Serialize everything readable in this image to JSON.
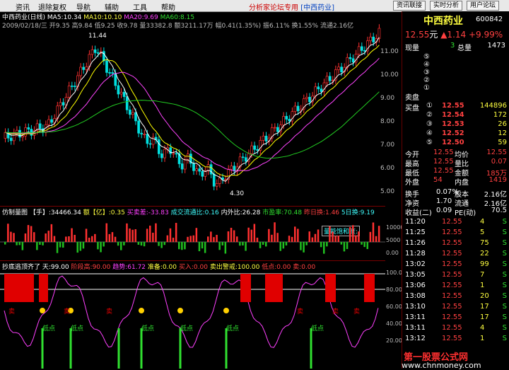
{
  "menu": {
    "items": [
      "资讯",
      "退除复权",
      "导航",
      "辅助",
      "工具",
      "帮助"
    ],
    "forum_text": "分析家论坛专用",
    "forum_link": "[中西药业]",
    "buttons": [
      "资讯联接",
      "实时分析",
      "用户论坛"
    ]
  },
  "chart": {
    "title": "中西药业(日线)",
    "ma5": "MA5:10.34",
    "ma10": "MA10:10.10",
    "ma20": "MA20:9.69",
    "ma60": "MA60:8.15",
    "info_line": "2009/02/18/三 开9.35 高9.84 低9.25 收9.78 量33382.8 额3211.17万 幅0.41(1.35%) 振6.11% 换1.55% 流通2.16亿",
    "high_label": "11.44",
    "low_label": "4.30",
    "y_ticks": [
      "11.00",
      "10.00",
      "9.00",
      "8.00",
      "7.00",
      "6.00",
      "5.00"
    ]
  },
  "panel2": {
    "title": "仿制量图",
    "hand": "【手】:34466.34",
    "amount": "额【亿】:0.35",
    "buy": "买卖差:-33.83",
    "flow": "成交流通比:0.16",
    "inout": "内外比:26.28",
    "pe": "市盈率:70.48",
    "yesterday": "昨日换:1.46",
    "five_day": "5日换:9.19",
    "annotation": "量能饱和度:",
    "y_ticks": [
      "10000",
      "5000",
      "0.00"
    ]
  },
  "panel3": {
    "title": "抄底逃顶齐了 天:99.00",
    "stage_high": "阶段高:90.00",
    "trend": "趋势:61.72",
    "prepare": "准备:0.00",
    "buy_in": "买入:0.00",
    "sell": "卖出警戒:100.00",
    "low_point": "低点:0.00",
    "sell2": "卖:0.00",
    "low_label": "低点",
    "y_ticks": [
      "100.00",
      "80.00",
      "60.00",
      "40.00",
      "20.00"
    ]
  },
  "quote": {
    "name": "中西药业",
    "code": "600842",
    "price": "12.55",
    "price_unit": "元",
    "change": "▲1.14",
    "change_pct": "+9.99%",
    "volume_now_label": "现量",
    "volume_now": "3",
    "total_label": "总量",
    "total": "1473",
    "sell_label": "卖盘",
    "sells": [
      "⑤",
      "④",
      "③",
      "②",
      "①"
    ],
    "buy_label": "买盘",
    "buys": [
      {
        "n": "①",
        "p": "12.55",
        "v": "144896"
      },
      {
        "n": "②",
        "p": "12.54",
        "v": "172"
      },
      {
        "n": "③",
        "p": "12.53",
        "v": "26"
      },
      {
        "n": "④",
        "p": "12.52",
        "v": "12"
      },
      {
        "n": "⑤",
        "p": "12.50",
        "v": "59"
      }
    ],
    "stats": [
      {
        "l": "今开",
        "v": "12.55",
        "l2": "均价",
        "v2": "12.55"
      },
      {
        "l": "最高",
        "v": "12.55",
        "l2": "量比",
        "v2": "0.07"
      },
      {
        "l": "最低",
        "v": "12.55",
        "l2": "金额",
        "v2": "185万"
      },
      {
        "l": "外盘",
        "v": "54",
        "l2": "内盘",
        "v2": "1419"
      }
    ],
    "stats2": [
      {
        "l": "换手",
        "v": "0.07%",
        "l2": "股本",
        "v2": "2.16亿"
      },
      {
        "l": "净资",
        "v": "1.70",
        "l2": "流通",
        "v2": "2.16亿"
      },
      {
        "l": "收益(二)",
        "v": "0.09",
        "l2": "PE(动)",
        "v2": "70.5"
      }
    ],
    "ticks": [
      {
        "t": "11:20",
        "p": "12.55",
        "v": "4",
        "s": "S"
      },
      {
        "t": "11:25",
        "p": "12.55",
        "v": "5",
        "s": "S"
      },
      {
        "t": "11:26",
        "p": "12.55",
        "v": "75",
        "s": "S"
      },
      {
        "t": "11:28",
        "p": "12.55",
        "v": "22",
        "s": "S"
      },
      {
        "t": "13:02",
        "p": "12.55",
        "v": "99",
        "s": "S"
      },
      {
        "t": "13:05",
        "p": "12.55",
        "v": "7",
        "s": "S"
      },
      {
        "t": "13:06",
        "p": "12.55",
        "v": "1",
        "s": "S"
      },
      {
        "t": "13:08",
        "p": "12.55",
        "v": "20",
        "s": "S"
      },
      {
        "t": "13:10",
        "p": "12.55",
        "v": "17",
        "s": "S"
      },
      {
        "t": "13:11",
        "p": "12.55",
        "v": "17",
        "s": "S"
      },
      {
        "t": "13:11",
        "p": "12.55",
        "v": "4",
        "s": "S"
      },
      {
        "t": "13:12",
        "p": "12.55",
        "v": "1",
        "s": "S"
      }
    ]
  },
  "watermark": {
    "title": "第一股票公式网",
    "url": "www.chnmoney.com"
  },
  "colors": {
    "ma5": "#ffffff",
    "ma10": "#ffff00",
    "ma20": "#ff40ff",
    "ma60": "#20c020",
    "up": "#ff3030",
    "down": "#00e0e0"
  }
}
